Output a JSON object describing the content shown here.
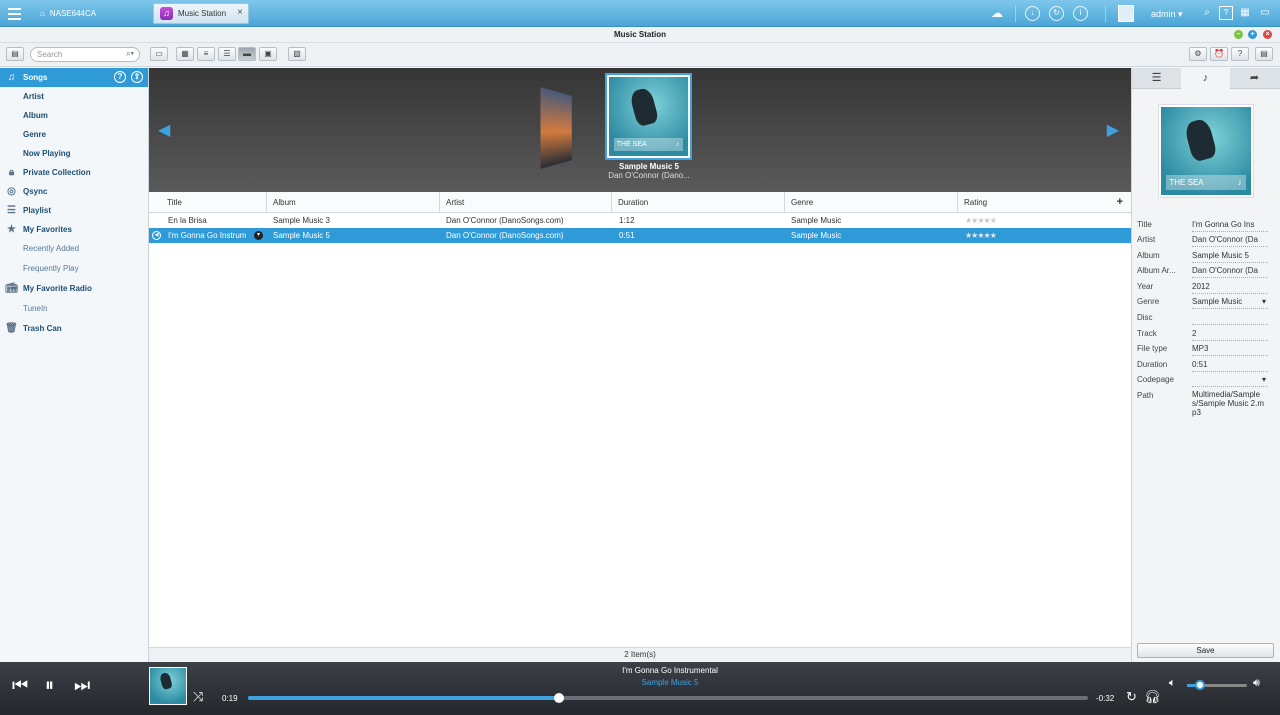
{
  "topbar": {
    "device_name": "NASE644CA",
    "app_tab_label": "Music Station",
    "user_name": "admin"
  },
  "window": {
    "title": "Music Station"
  },
  "toolbar": {
    "search_placeholder": "Search"
  },
  "sidebar": {
    "items": [
      {
        "label": "Songs",
        "icon": "music-note-icon",
        "active": true
      },
      {
        "label": "Artist"
      },
      {
        "label": "Album"
      },
      {
        "label": "Genre"
      },
      {
        "label": "Now Playing"
      },
      {
        "label": "Private Collection",
        "icon": "lock-icon"
      },
      {
        "label": "Qsync",
        "icon": "qsync-icon"
      },
      {
        "label": "Playlist",
        "icon": "playlist-icon"
      },
      {
        "label": "My Favorites",
        "icon": "star-icon"
      },
      {
        "label": "Recently Added"
      },
      {
        "label": "Frequently Play"
      },
      {
        "label": "My Favorite Radio",
        "icon": "radio-icon"
      },
      {
        "label": "TuneIn"
      },
      {
        "label": "Trash Can",
        "icon": "trash-icon"
      }
    ]
  },
  "coverflow": {
    "album": "Sample Music 5",
    "artist": "Dan O'Connor (Dano...",
    "cover_text": "THE SEA"
  },
  "table": {
    "columns": [
      "Title",
      "Album",
      "Artist",
      "Duration",
      "Genre",
      "Rating"
    ],
    "rows": [
      {
        "title": "En la Brisa",
        "album": "Sample Music 3",
        "artist": "Dan O'Connor (DanoSongs.com)",
        "duration": "1:12",
        "genre": "Sample Music",
        "rating": 0
      },
      {
        "title": "I'm Gonna Go Instrum",
        "album": "Sample Music 5",
        "artist": "Dan O'Connor (DanoSongs.com)",
        "duration": "0:51",
        "genre": "Sample Music",
        "rating": 0,
        "selected": true
      }
    ],
    "footer": "2 Item(s)"
  },
  "details": {
    "fields": [
      {
        "label": "Title",
        "value": "I'm Gonna Go Ins"
      },
      {
        "label": "Artist",
        "value": "Dan O'Connor (Da"
      },
      {
        "label": "Album",
        "value": "Sample Music 5"
      },
      {
        "label": "Album Ar...",
        "value": "Dan O'Connor (Da"
      },
      {
        "label": "Year",
        "value": "2012"
      },
      {
        "label": "Genre",
        "value": "Sample Music"
      },
      {
        "label": "Disc",
        "value": ""
      },
      {
        "label": "Track",
        "value": "2"
      },
      {
        "label": "File type",
        "value": "MP3"
      },
      {
        "label": "Duration",
        "value": "0:51"
      },
      {
        "label": "Codepage",
        "value": ""
      }
    ],
    "path_label": "Path",
    "path_value": "Multimedia/Samples/Sample Music 2.mp3",
    "save_label": "Save"
  },
  "player": {
    "title": "I'm Gonna Go Instrumental",
    "album": "Sample Music 5",
    "elapsed": "0:19",
    "remaining": "-0:32",
    "progress_fraction": 0.37,
    "volume_fraction": 0.22
  },
  "colors": {
    "accent": "#2f9ad8",
    "topbar": "#4aa6d8"
  }
}
